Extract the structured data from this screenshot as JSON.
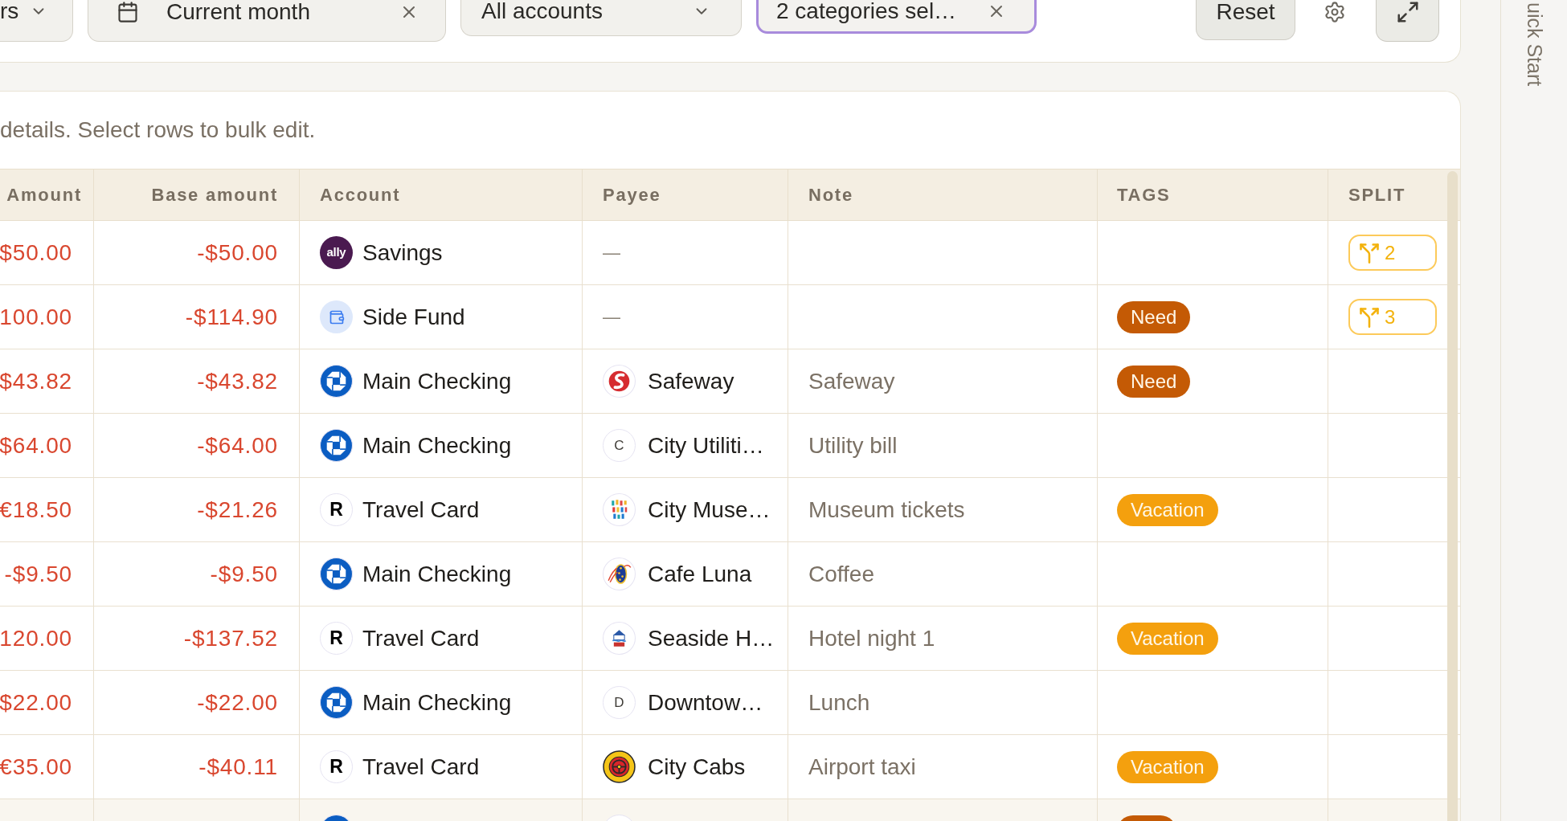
{
  "filters": [
    {
      "kind": "dropdown",
      "label": "rs",
      "focused": false
    },
    {
      "kind": "date",
      "label": "Current month",
      "focused": false
    },
    {
      "kind": "dropdown",
      "label": "All accounts",
      "focused": false
    },
    {
      "kind": "clearable",
      "label": "2 categories sel…",
      "focused": true
    }
  ],
  "actions": {
    "reset": "Reset"
  },
  "side_panel": {
    "tab": "uick Start"
  },
  "hint": "details. Select rows to bulk edit.",
  "table": {
    "columns": [
      "Amount",
      "Base amount",
      "Account",
      "Payee",
      "Note",
      "TAGS",
      "SPLIT"
    ],
    "rows": [
      {
        "highlighted": false,
        "amount": "$50.00",
        "base_amount": "-$50.00",
        "account": {
          "logo": {
            "kind": "monogram_dark",
            "text": "ally"
          },
          "name": "Savings"
        },
        "payee": {
          "name": "—"
        },
        "split": "2"
      },
      {
        "highlighted": false,
        "amount": "100.00",
        "base_amount": "-$114.90",
        "account": {
          "logo": {
            "kind": "wallet"
          },
          "name": "Side Fund"
        },
        "payee": {
          "name": "—"
        },
        "tags": [
          {
            "label": "Need",
            "color": "#c45a05"
          }
        ],
        "split": "3"
      },
      {
        "highlighted": false,
        "amount": "$43.82",
        "base_amount": "-$43.82",
        "account": {
          "logo": {
            "kind": "octagon"
          },
          "name": "Main Checking"
        },
        "payee": {
          "logo": {
            "kind": "swirl"
          },
          "name": "Safeway"
        },
        "note": "Safeway",
        "tags": [
          {
            "label": "Need",
            "color": "#c45a05"
          }
        ]
      },
      {
        "highlighted": false,
        "amount": "$64.00",
        "base_amount": "-$64.00",
        "account": {
          "logo": {
            "kind": "octagon"
          },
          "name": "Main Checking"
        },
        "payee": {
          "logo": {
            "kind": "letter",
            "text": "C"
          },
          "name": "City Utiliti…"
        },
        "note": "Utility bill"
      },
      {
        "highlighted": false,
        "amount": "€18.50",
        "base_amount": "-$21.26",
        "account": {
          "logo": {
            "kind": "monogram_light",
            "text": "R"
          },
          "name": "Travel Card"
        },
        "payee": {
          "logo": {
            "kind": "blocks"
          },
          "name": "City Muse…"
        },
        "note": "Museum tickets",
        "tags": [
          {
            "label": "Vacation",
            "color": "#f4a00e"
          }
        ]
      },
      {
        "highlighted": false,
        "amount": "-$9.50",
        "base_amount": "-$9.50",
        "account": {
          "logo": {
            "kind": "octagon"
          },
          "name": "Main Checking"
        },
        "payee": {
          "logo": {
            "kind": "oval"
          },
          "name": "Cafe Luna"
        },
        "note": "Coffee"
      },
      {
        "highlighted": false,
        "amount": "120.00",
        "base_amount": "-$137.52",
        "account": {
          "logo": {
            "kind": "monogram_light",
            "text": "R"
          },
          "name": "Travel Card"
        },
        "payee": {
          "logo": {
            "kind": "building"
          },
          "name": "Seaside H…"
        },
        "note": "Hotel night 1",
        "tags": [
          {
            "label": "Vacation",
            "color": "#f4a00e"
          }
        ]
      },
      {
        "highlighted": false,
        "amount": "$22.00",
        "base_amount": "-$22.00",
        "account": {
          "logo": {
            "kind": "octagon"
          },
          "name": "Main Checking"
        },
        "payee": {
          "logo": {
            "kind": "letter",
            "text": "D"
          },
          "name": "Downtow…"
        },
        "note": "Lunch"
      },
      {
        "highlighted": false,
        "amount": "€35.00",
        "base_amount": "-$40.11",
        "account": {
          "logo": {
            "kind": "monogram_light",
            "text": "R"
          },
          "name": "Travel Card"
        },
        "payee": {
          "logo": {
            "kind": "wheel"
          },
          "name": "City Cabs"
        },
        "note": "Airport taxi",
        "tags": [
          {
            "label": "Vacation",
            "color": "#f4a00e"
          }
        ]
      },
      {
        "highlighted": true,
        "account": {
          "logo": {
            "kind": "octagon"
          }
        },
        "payee": {
          "logo": {
            "kind": "letter"
          }
        },
        "tags": [
          {
            "color": "#c45a05"
          }
        ]
      }
    ]
  }
}
